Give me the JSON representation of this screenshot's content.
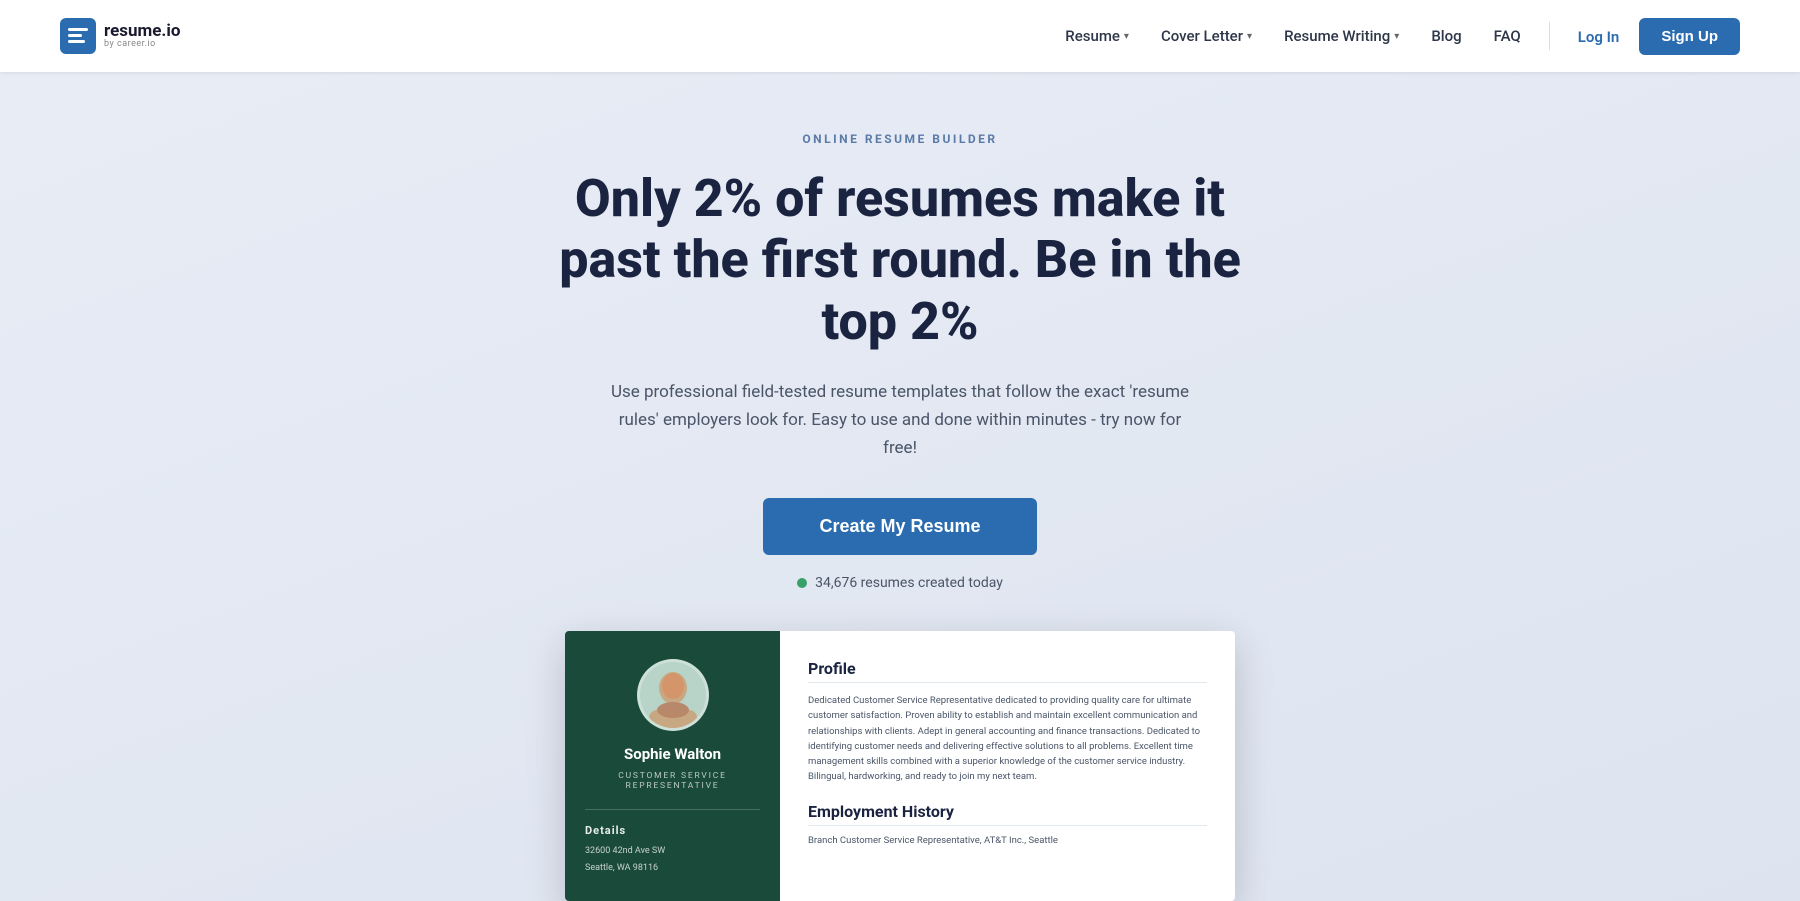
{
  "logo": {
    "icon_color": "#2b6cb0",
    "main": "resume.io",
    "sub": "by career.io"
  },
  "nav": {
    "items": [
      {
        "label": "Resume",
        "has_dropdown": true
      },
      {
        "label": "Cover Letter",
        "has_dropdown": true
      },
      {
        "label": "Resume Writing",
        "has_dropdown": true
      },
      {
        "label": "Blog",
        "has_dropdown": false
      },
      {
        "label": "FAQ",
        "has_dropdown": false
      }
    ],
    "login_label": "Log In",
    "signup_label": "Sign Up"
  },
  "hero": {
    "tag": "ONLINE RESUME BUILDER",
    "title": "Only 2% of resumes make it past the first round. Be in the top 2%",
    "subtitle": "Use professional field-tested resume templates that follow the exact 'resume rules' employers look for. Easy to use and done within minutes - try now for free!",
    "cta_label": "Create My Resume",
    "stat": "34,676 resumes created today"
  },
  "resume_preview": {
    "left": {
      "name": "Sophie Walton",
      "job_title": "CUSTOMER SERVICE\nREPRESENTATIVE",
      "details_label": "Details",
      "details_lines": [
        "32600 42nd Ave SW",
        "Seattle, WA 98116"
      ]
    },
    "right": {
      "profile_title": "Profile",
      "profile_text": "Dedicated Customer Service Representative dedicated to providing quality care for ultimate customer satisfaction. Proven ability to establish and maintain excellent communication and relationships with clients. Adept in general accounting and finance transactions. Dedicated to identifying customer needs and delivering effective solutions to all problems. Excellent time management skills combined with a superior knowledge of the customer service industry. Bilingual, hardworking, and ready to join my next team.",
      "employment_title": "Employment History",
      "employment_line": "Branch Customer Service Representative, AT&T Inc., Seattle"
    }
  }
}
